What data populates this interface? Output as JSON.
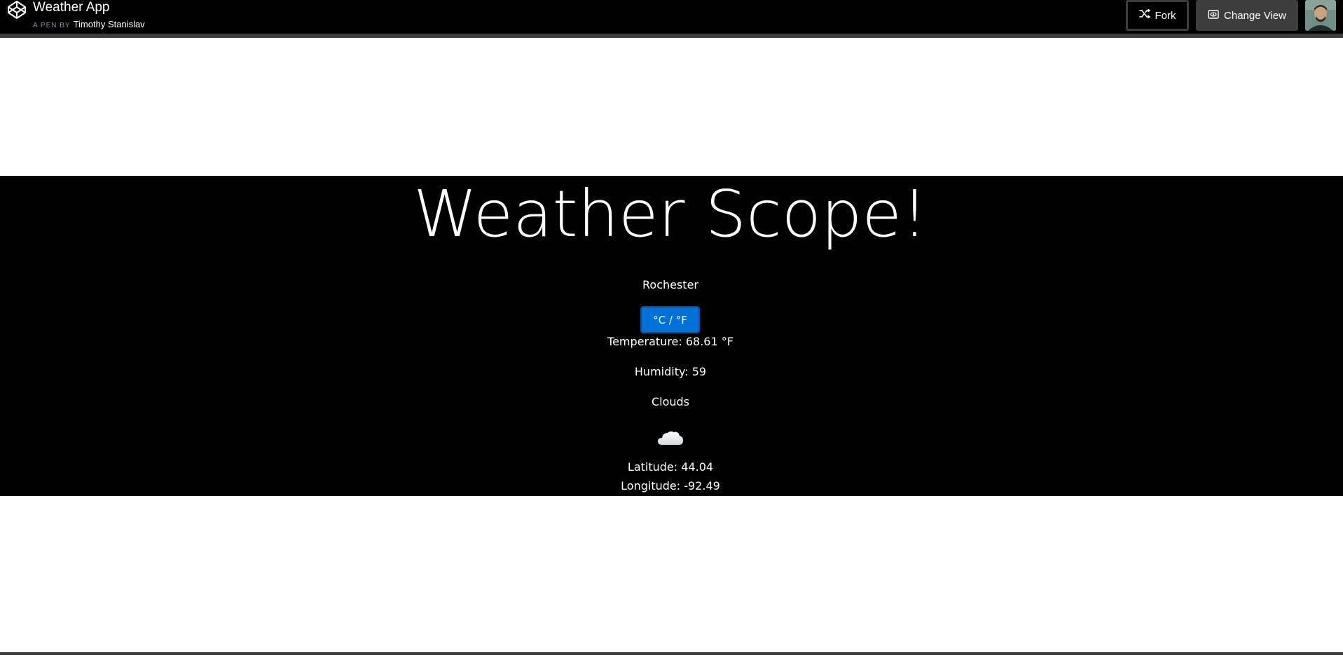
{
  "header": {
    "logo_icon": "codepen-logo-icon",
    "title": "Weather App",
    "byline_prefix": "A PEN BY",
    "author": "Timothy Stanislav",
    "fork_label": "Fork",
    "fork_icon": "fork-icon",
    "change_view_label": "Change View",
    "change_view_icon": "eye-icon",
    "avatar_icon": "user-avatar"
  },
  "weather": {
    "heading": "Weather Scope!",
    "city": "Rochester",
    "unit_toggle_label": "°C / °F",
    "temperature": "Temperature: 68.61 °F",
    "humidity": "Humidity: 59",
    "condition": "Clouds",
    "condition_icon": "cloud-icon",
    "latitude": "Latitude: 44.04",
    "longitude": "Longitude: -92.49"
  },
  "colors": {
    "header_bg": "#000000",
    "band_bg": "#000000",
    "toggle_bg": "#0071d8",
    "text": "#ffffff"
  }
}
